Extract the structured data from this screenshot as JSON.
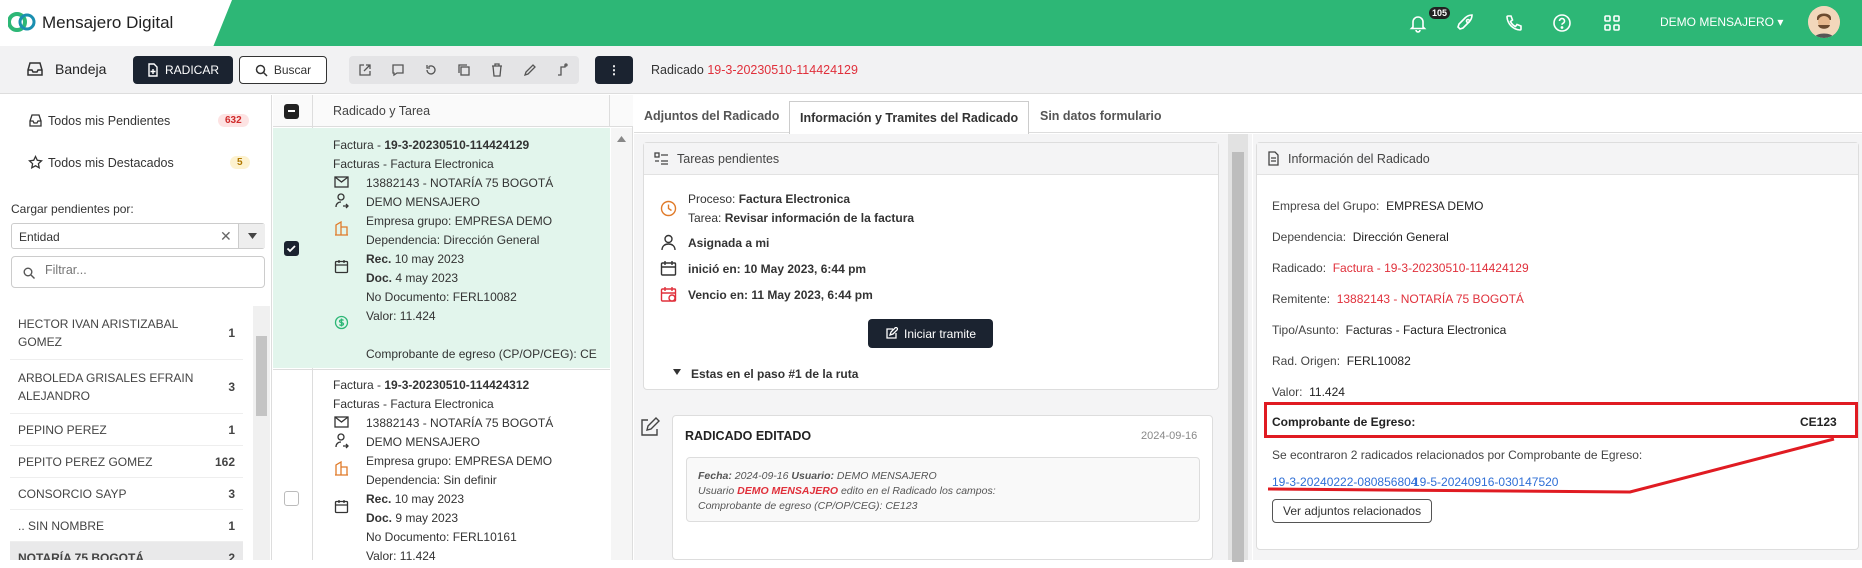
{
  "topbar": {
    "app_name": "Mensajero Digital",
    "notif_count": "105",
    "user_name": "DEMO MENSAJERO ▾",
    "brand_color": "#2db776"
  },
  "toolbar": {
    "bandeja_label": "Bandeja",
    "radicar_label": "RADICAR",
    "buscar_label": "Buscar",
    "more_label": "⋮",
    "radicado_prefix": "Radicado",
    "radicado_id": "19-3-20230510-114424129"
  },
  "sidebar": {
    "pendientes_label": "Todos mis Pendientes",
    "pendientes_count": "632",
    "destacados_label": "Todos mis Destacados",
    "destacados_count": "5",
    "cargar_label": "Cargar pendientes por:",
    "select_value": "Entidad",
    "filter_placeholder": "Filtrar...",
    "entities": [
      {
        "name": "HECTOR IVAN ARISTIZABAL GOMEZ",
        "count": "1"
      },
      {
        "name": "ARBOLEDA GRISALES EFRAIN ALEJANDRO",
        "count": "3"
      },
      {
        "name": "PEPINO PEREZ",
        "count": "1"
      },
      {
        "name": "PEPITO PEREZ GOMEZ",
        "count": "162"
      },
      {
        "name": "CONSORCIO SAYP",
        "count": "3"
      },
      {
        "name": ".. SIN NOMBRE",
        "count": "1"
      },
      {
        "name": "NOTARÍA 75 BOGOTÁ",
        "count": "2"
      }
    ]
  },
  "list": {
    "header": "Radicado y Tarea",
    "items": [
      {
        "title_prefix": "Factura - ",
        "title_id": "19-3-20230510-114424129",
        "subtitle": "Facturas - Factura Electronica",
        "remitente": "13882143 - NOTARÍA 75 BOGOTÁ",
        "usuario": "DEMO MENSAJERO",
        "empresa_label": "Empresa grupo: ",
        "empresa": "EMPRESA DEMO",
        "dep_label": "Dependencia: ",
        "dep": "Dirección General",
        "rec_label": "Rec. ",
        "rec": "10 may 2023",
        "doc_label": "Doc. ",
        "doc": "4 may 2023",
        "nodoc_label": "No Documento: ",
        "nodoc": "FERL10082",
        "valor_label": "Valor: ",
        "valor": "11.424",
        "comprobante": "Comprobante de egreso (CP/OP/CEG): CE"
      },
      {
        "title_prefix": "Factura - ",
        "title_id": "19-3-20230510-114424312",
        "subtitle": "Facturas - Factura Electronica",
        "remitente": "13882143 - NOTARÍA 75 BOGOTÁ",
        "usuario": "DEMO MENSAJERO",
        "empresa_label": "Empresa grupo: ",
        "empresa": "EMPRESA DEMO",
        "dep_label": "Dependencia: ",
        "dep": "Sin definir",
        "rec_label": "Rec. ",
        "rec": "10 may 2023",
        "doc_label": "Doc. ",
        "doc": "9 may 2023",
        "nodoc_label": "No Documento: ",
        "nodoc": "FERL10161",
        "valor_label": "Valor: ",
        "valor": "11.424"
      }
    ]
  },
  "tabs": [
    "Adjuntos del Radicado",
    "Información y Tramites del Radicado",
    "Sin datos formulario"
  ],
  "tareas": {
    "title": "Tareas pendientes",
    "proceso_label": "Proceso: ",
    "proceso": "Factura Electronica",
    "tarea_label": "Tarea: ",
    "tarea": "Revisar información de la factura",
    "asignada": "Asignada a mi",
    "inicio": "inició en: 10 May 2023, 6:44 pm",
    "vence": "Vencio en: 11 May 2023, 6:44 pm",
    "iniciar_label": "Iniciar tramite",
    "paso": "Estas en el paso #1 de la ruta"
  },
  "history": {
    "title": "RADICADO EDITADO",
    "date": "2024-09-16",
    "fecha_label": "Fecha:",
    "fecha": "2024-09-16",
    "usuario_label": "Usuario:",
    "usuario": "DEMO MENSAJERO",
    "line2_prefix": "Usuario",
    "line2_user": "DEMO MENSAJERO",
    "line2_suffix": "edito en el Radicado los campos:",
    "line3": "Comprobante de egreso (CP/OP/CEG): CE123"
  },
  "info": {
    "title": "Información del Radicado",
    "empresa_label": "Empresa del Grupo:",
    "empresa": "EMPRESA DEMO",
    "dep_label": "Dependencia:",
    "dep": "Dirección General",
    "radicado_label": "Radicado:",
    "radicado": "Factura - 19-3-20230510-114424129",
    "remitente_label": "Remitente:",
    "remitente": "13882143 - NOTARÍA 75 BOGOTÁ",
    "tipo_label": "Tipo/Asunto:",
    "tipo": "Facturas - Factura Electronica",
    "origen_label": "Rad. Origen:",
    "origen": "FERL10082",
    "valor_label": "Valor:",
    "valor": "11.424",
    "comprobante_label": "Comprobante de Egreso:",
    "comprobante": "CE123",
    "found_text": "Se econtraron 2 radicados relacionados por Comprobante de Egreso:",
    "link1": "19-3-20240222-080856804",
    "link2": "19-5-20240916-030147520",
    "ver_label": "Ver adjuntos relacionados"
  },
  "colors": {
    "accent_red": "#e0303b",
    "link_blue": "#2f6fd6",
    "dark": "#1b2330"
  }
}
